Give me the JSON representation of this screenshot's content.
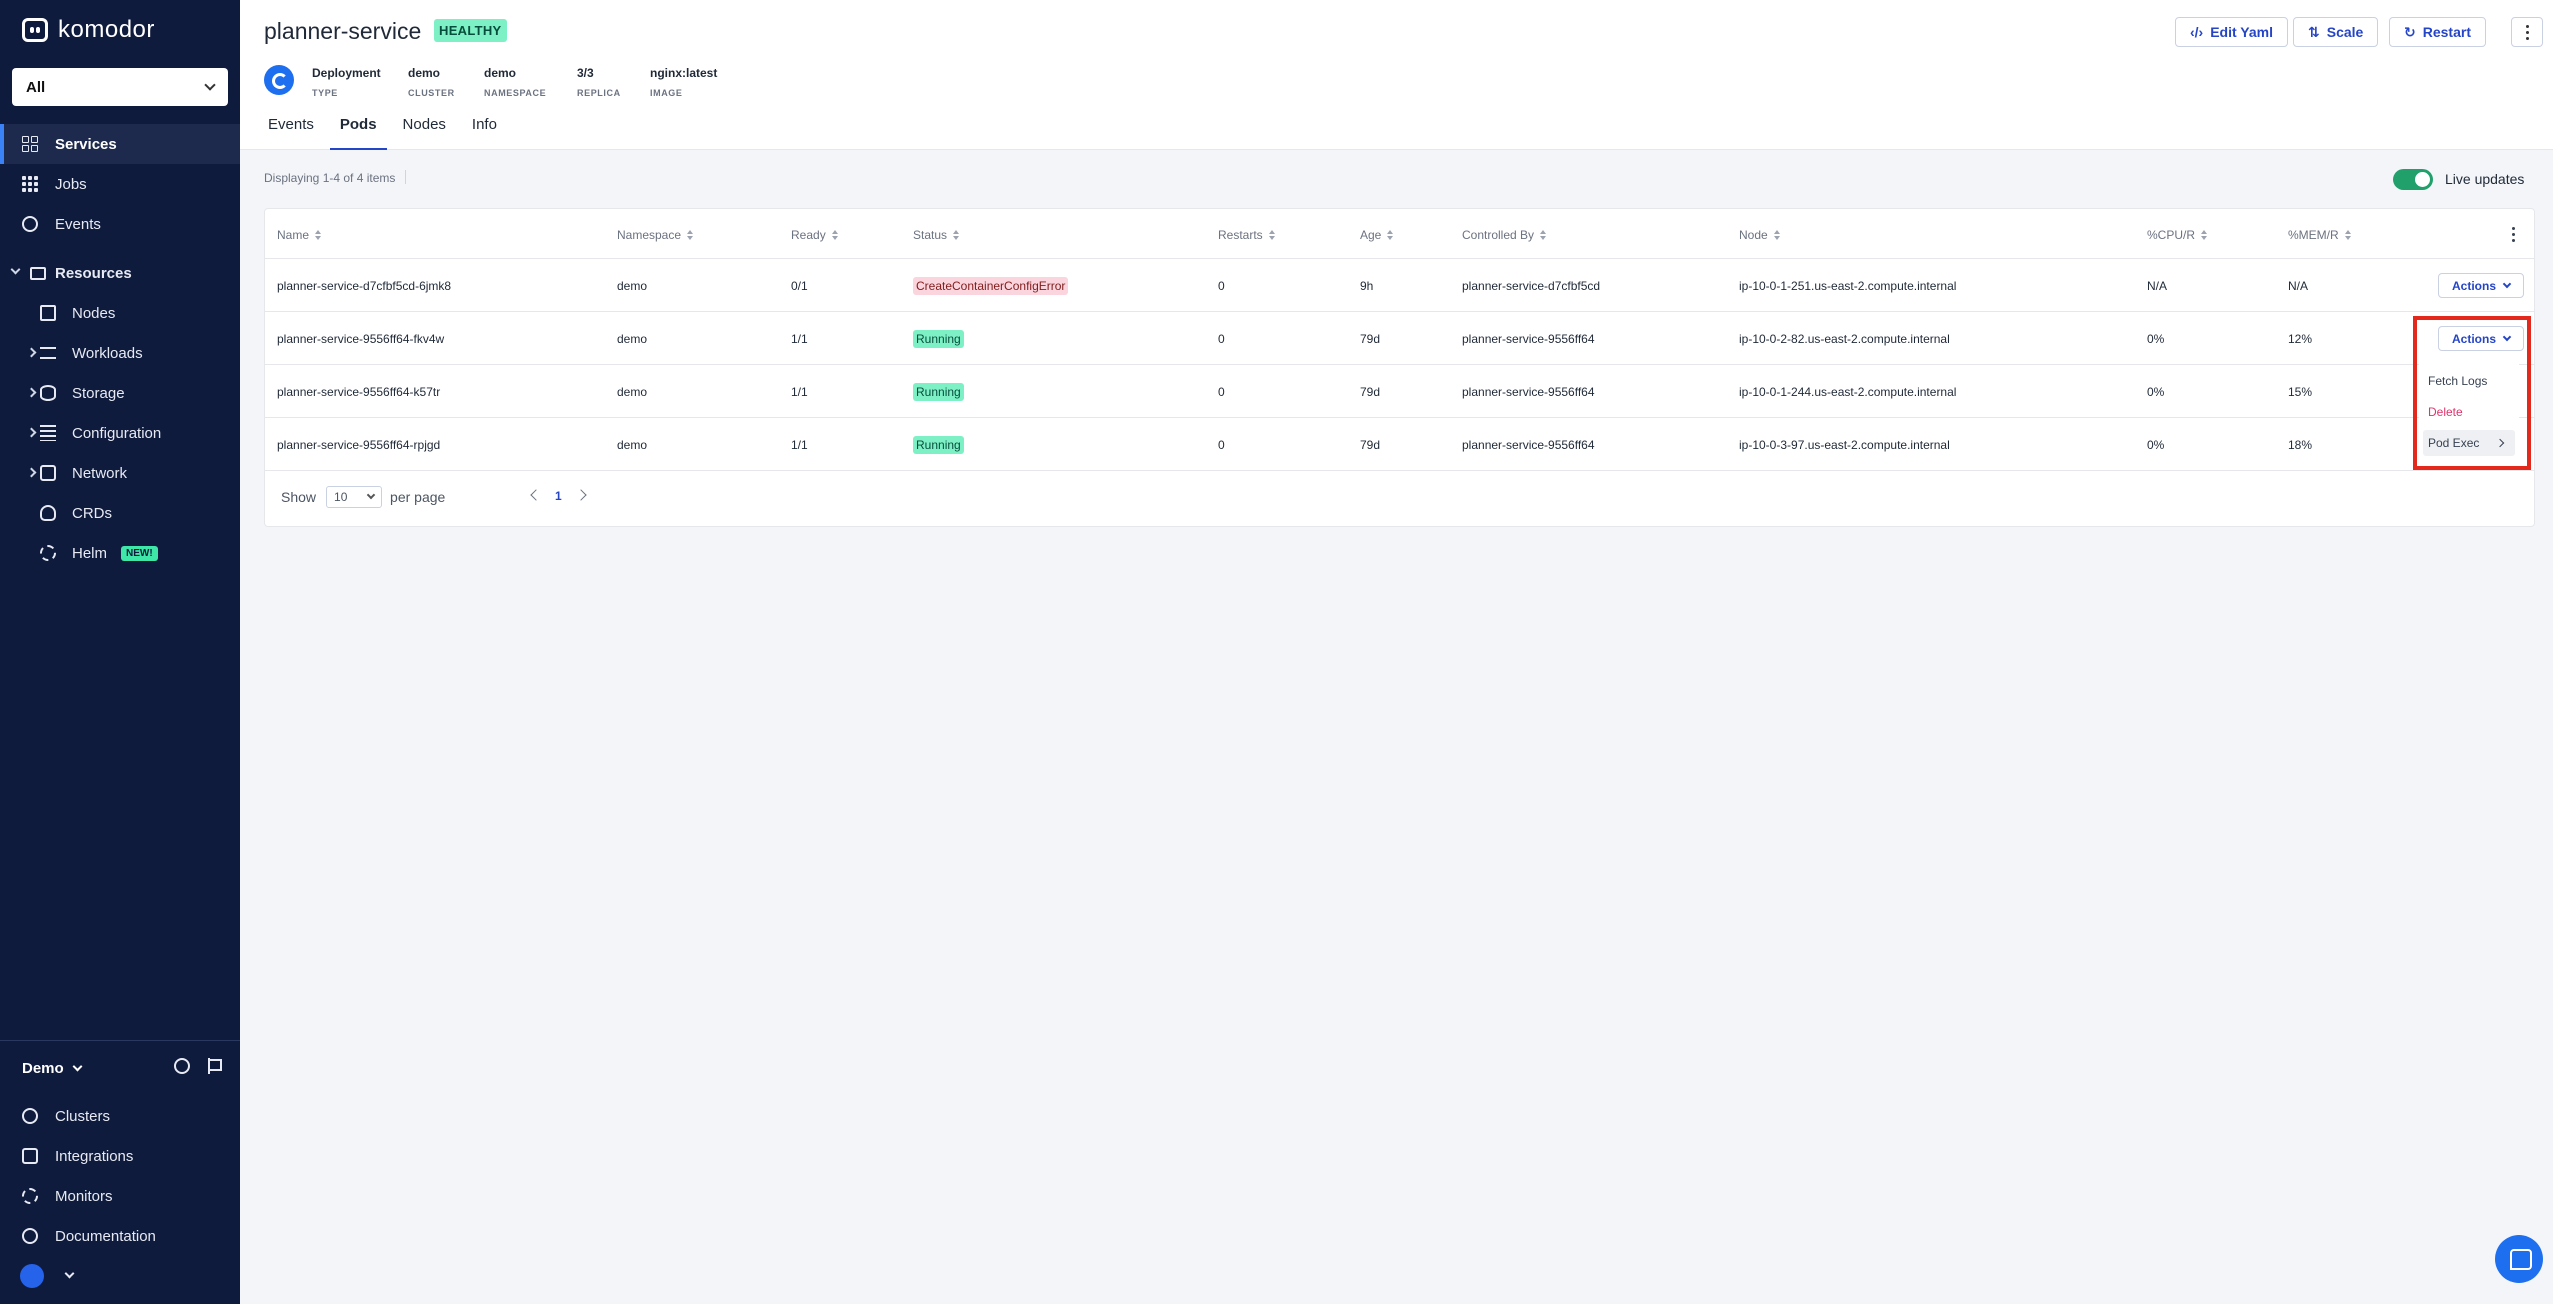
{
  "app": {
    "logo_text": "komodor"
  },
  "sidebar": {
    "workspace": "All",
    "items": [
      {
        "label": "Services",
        "icon": "grid-icon"
      },
      {
        "label": "Jobs",
        "icon": "dots-grid-icon"
      },
      {
        "label": "Events",
        "icon": "clock-icon"
      }
    ],
    "resources_label": "Resources",
    "resources": [
      {
        "label": "Nodes",
        "icon": "server-icon"
      },
      {
        "label": "Workloads",
        "icon": "box-icon"
      },
      {
        "label": "Storage",
        "icon": "database-icon"
      },
      {
        "label": "Configuration",
        "icon": "list-icon"
      },
      {
        "label": "Network",
        "icon": "network-icon"
      },
      {
        "label": "CRDs",
        "icon": "crd-icon"
      },
      {
        "label": "Helm",
        "icon": "helm-icon",
        "badge": "NEW!"
      }
    ],
    "account": "Demo",
    "bottom": [
      {
        "label": "Clusters",
        "icon": "clusters-icon"
      },
      {
        "label": "Integrations",
        "icon": "plug-icon"
      },
      {
        "label": "Monitors",
        "icon": "monitor-icon"
      },
      {
        "label": "Documentation",
        "icon": "help-icon"
      }
    ]
  },
  "header": {
    "title": "planner-service",
    "health": "HEALTHY",
    "meta": [
      {
        "value": "Deployment",
        "key": "TYPE"
      },
      {
        "value": "demo",
        "key": "CLUSTER"
      },
      {
        "value": "demo",
        "key": "NAMESPACE"
      },
      {
        "value": "3/3",
        "key": "REPLICA"
      },
      {
        "value": "nginx:latest",
        "key": "IMAGE"
      }
    ],
    "buttons": {
      "edit_yaml": "Edit Yaml",
      "scale": "Scale",
      "restart": "Restart"
    },
    "tabs": [
      "Events",
      "Pods",
      "Nodes",
      "Info"
    ],
    "active_tab": "Pods"
  },
  "pods": {
    "display_count": "Displaying 1-4 of 4 items",
    "live_updates": "Live updates",
    "live_updates_on": true,
    "columns": [
      "Name",
      "Namespace",
      "Ready",
      "Status",
      "Restarts",
      "Age",
      "Controlled By",
      "Node",
      "%CPU/R",
      "%MEM/R"
    ],
    "rows": [
      {
        "name": "planner-service-d7cfbf5cd-6jmk8",
        "namespace": "demo",
        "ready": "0/1",
        "status": "CreateContainerConfigError",
        "status_kind": "error",
        "restarts": "0",
        "age": "9h",
        "controlled_by": "planner-service-d7cfbf5cd",
        "node": "ip-10-0-1-251.us-east-2.compute.internal",
        "cpu": "N/A",
        "mem": "N/A",
        "actions": "Actions"
      },
      {
        "name": "planner-service-9556ff64-fkv4w",
        "namespace": "demo",
        "ready": "1/1",
        "status": "Running",
        "status_kind": "running",
        "restarts": "0",
        "age": "79d",
        "controlled_by": "planner-service-9556ff64",
        "node": "ip-10-0-2-82.us-east-2.compute.internal",
        "cpu": "0%",
        "mem": "12%",
        "actions": "Actions"
      },
      {
        "name": "planner-service-9556ff64-k57tr",
        "namespace": "demo",
        "ready": "1/1",
        "status": "Running",
        "status_kind": "running",
        "restarts": "0",
        "age": "79d",
        "controlled_by": "planner-service-9556ff64",
        "node": "ip-10-0-1-244.us-east-2.compute.internal",
        "cpu": "0%",
        "mem": "15%"
      },
      {
        "name": "planner-service-9556ff64-rpjgd",
        "namespace": "demo",
        "ready": "1/1",
        "status": "Running",
        "status_kind": "running",
        "restarts": "0",
        "age": "79d",
        "controlled_by": "planner-service-9556ff64",
        "node": "ip-10-0-3-97.us-east-2.compute.internal",
        "cpu": "0%",
        "mem": "18%"
      }
    ],
    "pagination": {
      "show_label": "Show",
      "page_size": "10",
      "per_page_label": "per page",
      "current_page": "1"
    },
    "actions_menu": {
      "fetch_logs": "Fetch Logs",
      "delete": "Delete",
      "pod_exec": "Pod Exec"
    }
  },
  "colors": {
    "sidebar_bg": "#0f1b3d",
    "accent": "#2545c7",
    "healthy": "#7ef0c5",
    "error": "#fbd5dd",
    "highlight": "#e5281c"
  }
}
